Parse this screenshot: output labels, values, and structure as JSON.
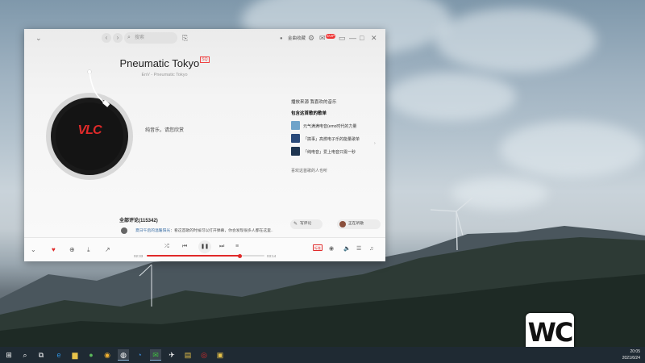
{
  "window": {
    "search_placeholder": "搜索",
    "user_name": "金曲收藏",
    "vip_badge": "SVIP"
  },
  "song": {
    "title": "Pneumatic Tokyo",
    "title_tag": "SQ",
    "subtitle": "EnV - Pneumatic Tokyo",
    "album_logo": "VLC",
    "lyric": "纯音乐，请您欣赏"
  },
  "side_panel": {
    "source": "播放来源  我喜欢的音乐",
    "heading": "包含这首歌的歌单",
    "playlists": [
      {
        "name": "元气满满电音(emo时代的力量",
        "color": "#6fa3c9"
      },
      {
        "name": "「搞事」高燃电子乐的能量歌单",
        "color": "#2a4a7a"
      },
      {
        "name": "「纯电音」爱上电音只需一秒",
        "color": "#1e3550"
      }
    ],
    "more": "喜欢这首歌的人也听"
  },
  "comments": {
    "header": "全部评论(115342)",
    "first_user": "夏日午后的温暖阳光",
    "first_text": "：看这首歌的时候可以打开弹幕，你会发现很多人都在这里..",
    "write_label": "写评论",
    "listen_label": "正在听歌"
  },
  "player": {
    "current_time": "02:33",
    "total_time": "03:14",
    "progress_fraction": 0.79,
    "hq_label": "标准"
  },
  "taskbar": {
    "time": "20:05",
    "date": "2021/6/24"
  },
  "watermark": "WC",
  "colors": {
    "accent": "#e02a2a",
    "taskbar": "#1f2a33"
  }
}
